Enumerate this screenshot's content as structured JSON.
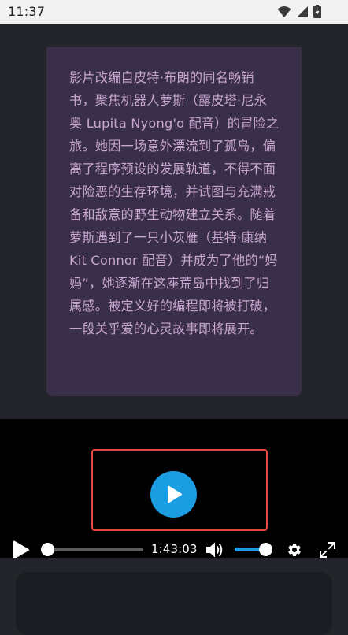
{
  "status_bar": {
    "time": "11:37",
    "icons": [
      "wifi-icon",
      "signal-icon",
      "battery-charging-icon"
    ]
  },
  "synopsis": {
    "text": "影片改编自皮特·布朗的同名畅销书，聚焦机器人萝斯（露皮塔·尼永奥 Lupita Nyong'o 配音）的冒险之旅。她因一场意外漂流到了孤岛，偏离了程序预设的发展轨道，不得不面对险恶的生存环境，并试图与充满戒备和敌意的野生动物建立关系。随着萝斯遇到了一只小灰雁（基特·康纳 Kit Connor 配音）并成为了他的“妈妈”，她逐渐在这座荒岛中找到了归属感。被定义好的编程即将被打破，一段关乎爱的心灵故事即将展开。"
  },
  "player": {
    "time_display": "1:43:03",
    "progress": 0,
    "volume": 1.0,
    "accent_color": "#1a9ee1",
    "highlight_color": "#e5483e",
    "icons": {
      "big_play": "play-icon",
      "play": "play-icon",
      "volume": "volume-icon",
      "settings": "gear-icon",
      "fullscreen": "fullscreen-icon"
    }
  },
  "colors": {
    "page_background": "#23252b",
    "card_background": "#3a2f49",
    "synopsis_text": "#c8a6d0"
  }
}
